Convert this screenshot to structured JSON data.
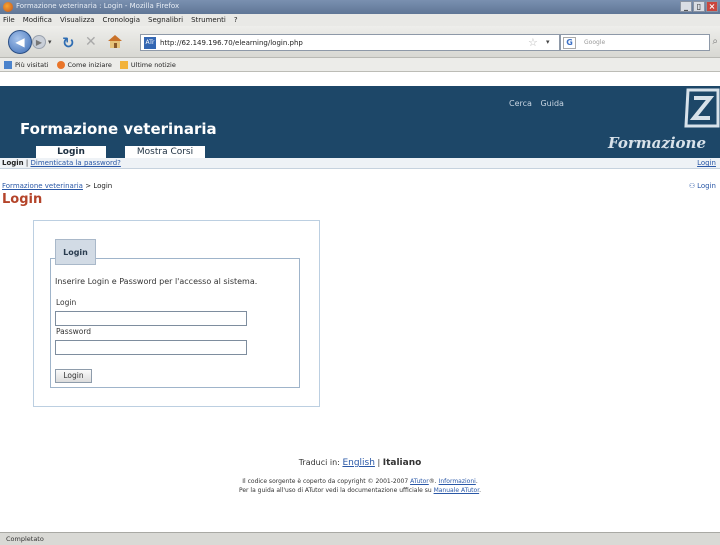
{
  "window": {
    "title": "Formazione veterinaria : Login - Mozilla Firefox",
    "buttons": {
      "minimize": "_",
      "maximize": "▯",
      "close": "×"
    }
  },
  "menu": [
    "File",
    "Modifica",
    "Visualizza",
    "Cronologia",
    "Segnalibri",
    "Strumenti",
    "?"
  ],
  "toolbar": {
    "url": "http://62.149.196.70/elearning/login.php",
    "site_icon_text": "ATr",
    "search_engine_letter": "G",
    "search_placeholder": "Google",
    "icons": [
      "back-icon",
      "forward-icon",
      "reload-icon",
      "stop-icon",
      "home-icon",
      "star-icon",
      "search-icon"
    ]
  },
  "bookmarks": [
    "Più visitati",
    "Come iniziare",
    "Ultime notizie"
  ],
  "site": {
    "links": [
      "Cerca",
      "Guida"
    ],
    "title": "Formazione veterinaria",
    "logo_text": "Formazione",
    "tabs": [
      "Login",
      "Mostra Corsi"
    ],
    "colors": {
      "header": "#1d4768",
      "title_accent": "#b4442a",
      "link": "#2a58a7"
    }
  },
  "subnav": {
    "current": "Login",
    "separator": "|",
    "forgot": "Dimenticata la password?",
    "right_link": "Login"
  },
  "breadcrumb": {
    "root": "Formazione veterinaria",
    "separator": ">",
    "current": "Login",
    "right": "Login"
  },
  "page": {
    "title": "Login"
  },
  "login_form": {
    "legend": "Login",
    "instructions": "Inserire Login e Password per l'accesso al sistema.",
    "login_label": "Login",
    "login_value": "",
    "password_label": "Password",
    "password_value": "",
    "submit_label": "Login"
  },
  "footer": {
    "translate_prefix": "Traduci in:",
    "lang_english": "English",
    "lang_sep": "|",
    "lang_current": "Italiano",
    "copyright_1a": "Il codice sorgente è coperto da copyright © 2001-2007",
    "copyright_1b": "ATutor",
    "copyright_1c": "®.",
    "copyright_1d": "Informazioni",
    "copyright_1e": ".",
    "copyright_2a": "Per la guida all'uso di ATutor vedi la documentazione ufficiale su",
    "copyright_2b": "Manuale ATutor",
    "copyright_2c": "."
  },
  "status": {
    "text": "Completato"
  }
}
